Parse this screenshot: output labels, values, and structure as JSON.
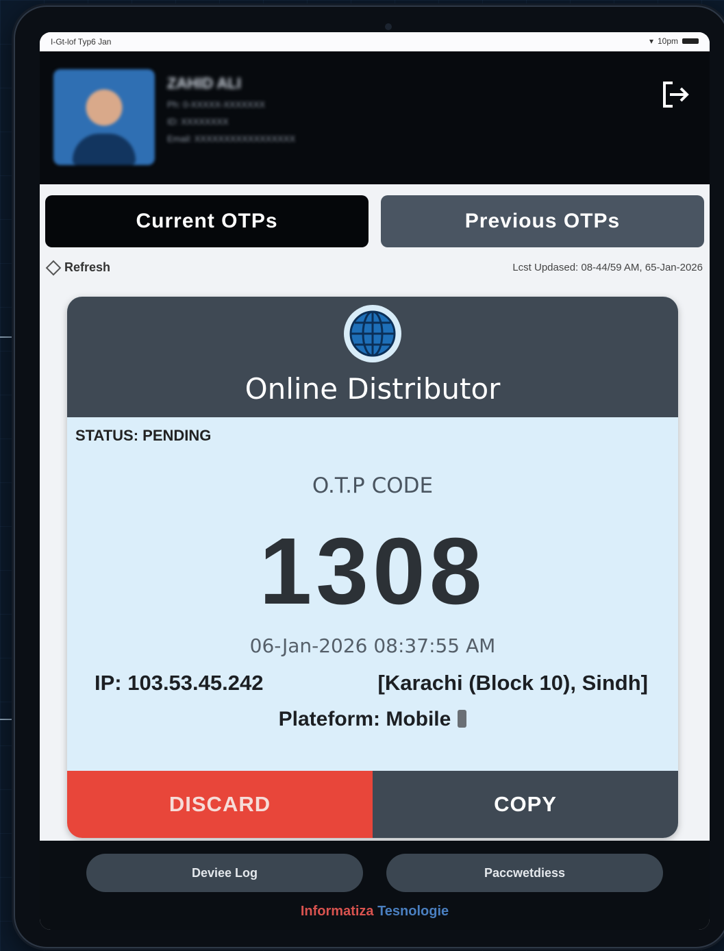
{
  "status_bar": {
    "left_text": "I-Gt-lof Typ6 Jan",
    "right_text": "10pm"
  },
  "header": {
    "user_name": "ZAHID ALI",
    "user_line_1": "Ph: 0-XXXXX-XXXXXXX",
    "user_line_2": "ID: XXXXXXXX",
    "user_line_3": "Email: XXXXXXXXXXXXXXXXX"
  },
  "tabs": [
    {
      "label": "Current OTPs",
      "active": true
    },
    {
      "label": "Previous OTPs",
      "active": false
    }
  ],
  "refresh_label": "Refresh",
  "last_updated": "Lcst Updased: 08-44/59 AM, 65-Jan-2026",
  "card": {
    "title": "Online Distributor",
    "status": "STATUS: PENDING",
    "otp_label": "O.T.P CODE",
    "otp_code": "1308",
    "timestamp": "06-Jan-2026 08:37:55 AM",
    "ip": "IP: 103.53.45.242",
    "location": "[Karachi (Block 10), Sindh]",
    "platform": "Plateform: Mobile",
    "discard_label": "DISCARD",
    "copy_label": "COPY"
  },
  "footer": {
    "device_log_label": "Deviee Log",
    "passwords_label": "Paccwetdiess",
    "brand_part1": "Informatiza",
    "brand_part2": "Tesnologie"
  },
  "colors": {
    "accent_dark": "#3f4954",
    "discard": "#e8463a",
    "card_bg": "#dbeefa",
    "brand_red": "#d9534f",
    "brand_blue": "#4a7fc0"
  }
}
